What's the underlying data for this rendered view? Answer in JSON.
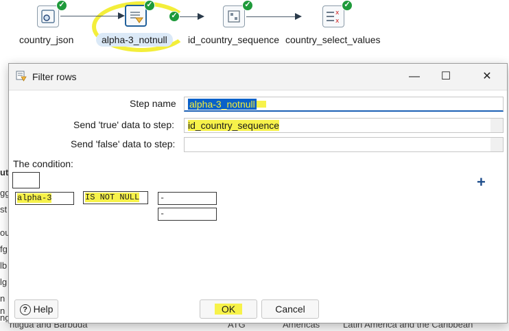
{
  "workflow": {
    "steps": [
      {
        "label": "country_json",
        "icon": "json-input-icon"
      },
      {
        "label": "alpha-3_notnull",
        "icon": "filter-rows-icon"
      },
      {
        "label": "id_country_sequence",
        "icon": "sequence-icon"
      },
      {
        "label": "country_select_values",
        "icon": "select-values-icon"
      }
    ],
    "status_icon": "check-icon",
    "status_color": "#1f9a3b",
    "highlight_color": "#f3ee3a"
  },
  "background": {
    "left_cells": [
      "ut",
      "gg",
      "st",
      "ou",
      "fg",
      "lb",
      "lg",
      "n",
      "n",
      "ng"
    ],
    "bottom_row": [
      "ntigua and Barbuda",
      "ATG",
      "Americas",
      "Latin America and the Caribbean"
    ]
  },
  "dialog": {
    "title": "Filter rows",
    "title_icon": "filter-icon",
    "minimize_label": "—",
    "maximize_label": "☐",
    "close_label": "✕",
    "step_name_label": "Step name",
    "step_name_value": "alpha-3_notnull",
    "true_label": "Send 'true' data to step:",
    "true_value": "id_country_sequence",
    "false_label": "Send 'false' data to step:",
    "false_value": "",
    "condition_label": "The condition:",
    "condition": {
      "field": "alpha-3",
      "operator": "IS NOT NULL",
      "value1": "-",
      "value2": "-"
    },
    "add_icon": "plus-icon",
    "help_label": "Help",
    "ok_label": "OK",
    "cancel_label": "Cancel",
    "accent_color": "#1a5fb4"
  }
}
